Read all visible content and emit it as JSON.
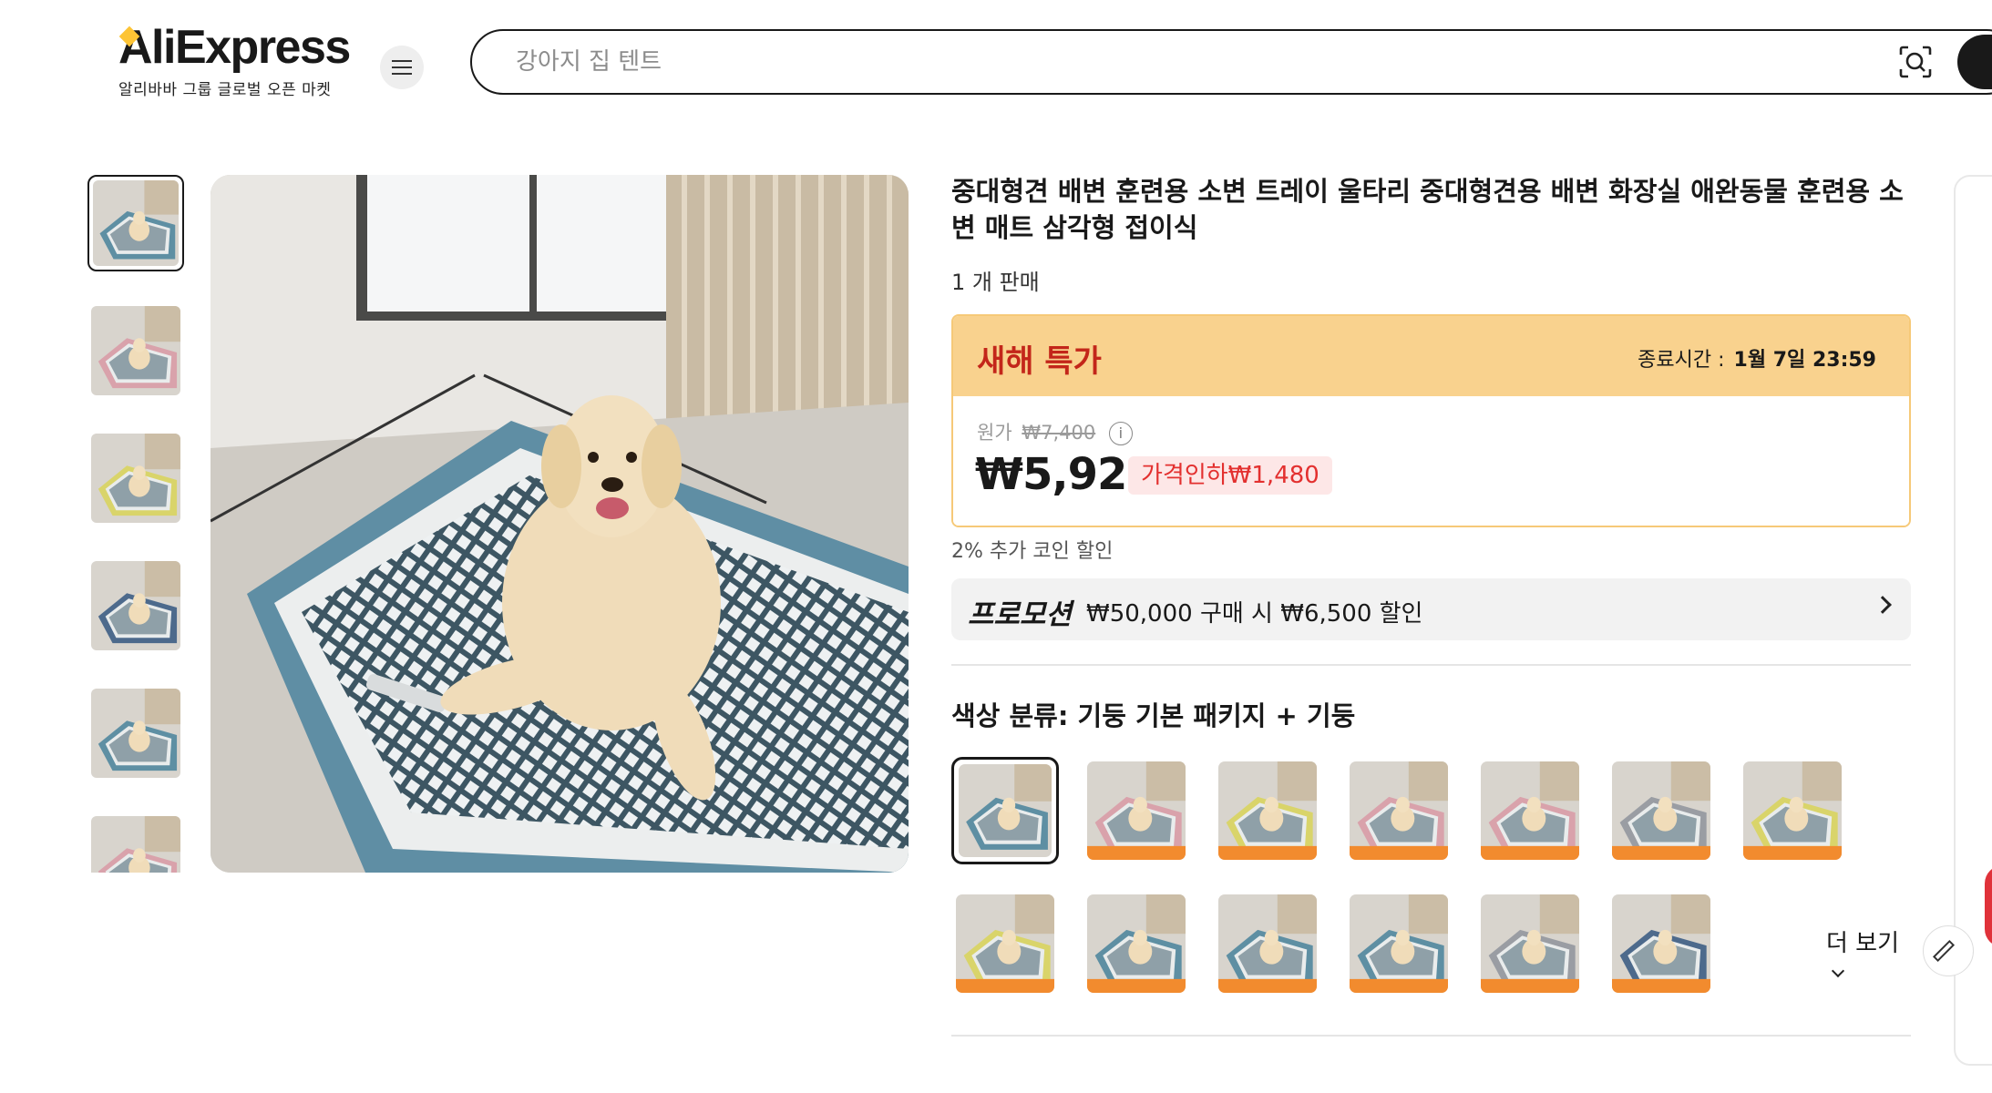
{
  "header": {
    "logo_text": "AliExpress",
    "logo_sub": "알리바바 그룹 글로벌 오픈 마켓",
    "search_placeholder": "강아지 집 텐트"
  },
  "product": {
    "title": "중대형견 배변 훈련용 소변 트레이 울타리 중대형견용 배변 화장실 애완동물 훈련용 소변 매트 삼각형 접이식",
    "sold": "1 개 판매",
    "deal": {
      "title": "새해 특가",
      "ends_label": "종료시간 :",
      "ends_value": "1월 7일 23:59",
      "orig_label": "원가",
      "orig_price": "₩7,400",
      "price": "₩5,920",
      "price_cut": "가격인하₩1,480"
    },
    "coin_note": "2% 추가 코인 할인",
    "promo": {
      "label": "프로모션",
      "text": "₩50,000 구매 시 ₩6,500 할인"
    },
    "color_label": "색상 분류: 기둥 기본 패키지 + 기둥",
    "more_label": "더 보기"
  },
  "thumbnails": [
    "blue",
    "pink",
    "yellow",
    "navy",
    "blue",
    "pink"
  ],
  "swatches": [
    "blue",
    "pink",
    "yellow",
    "pink",
    "pink",
    "grey",
    "yellow",
    "yellow",
    "blue",
    "blue",
    "blue",
    "grey",
    "navy"
  ],
  "colors": {
    "blue": "#5e8fa3",
    "pink": "#d9a2ab",
    "yellow": "#d9d46a",
    "navy": "#4d6a8c",
    "grey": "#9a9da3",
    "accent_red": "#e3302f",
    "deal_yellow": "#f9d28e"
  }
}
